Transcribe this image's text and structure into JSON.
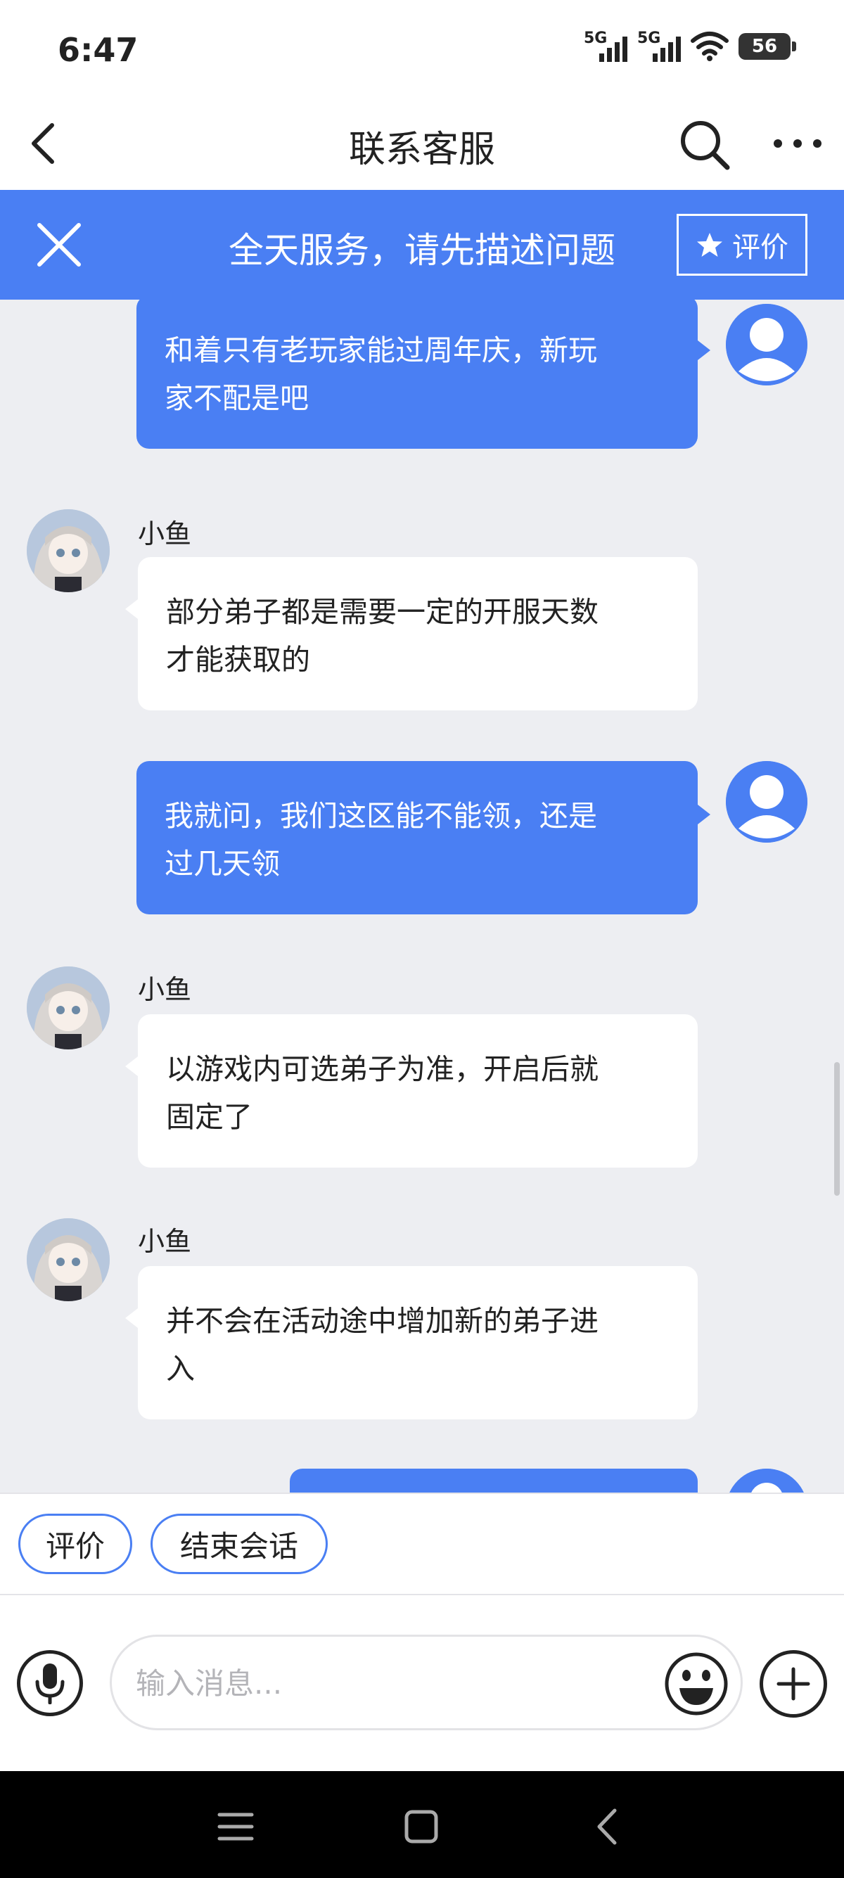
{
  "status_bar": {
    "time": "6:47",
    "network_1": "5G",
    "network_2": "5G",
    "battery": "56"
  },
  "header": {
    "title": "联系客服",
    "back_icon": "chevron-left-icon",
    "search_icon": "search-icon",
    "more_icon": "more-horizontal-icon"
  },
  "banner": {
    "text": "全天服务，请先描述问题",
    "rate_label": "评价",
    "close_icon": "close-icon",
    "star_icon": "star-icon"
  },
  "chat": {
    "messages": [
      {
        "from": "user",
        "lines": [
          "和着只有老玩家能过周年庆，新玩",
          "家不配是吧"
        ]
      },
      {
        "from": "agent",
        "sender": "小鱼",
        "lines": [
          "部分弟子都是需要一定的开服天数",
          "才能获取的"
        ]
      },
      {
        "from": "user",
        "lines": [
          "我就问，我们这区能不能领，还是",
          "过几天领"
        ]
      },
      {
        "from": "agent",
        "sender": "小鱼",
        "lines": [
          "以游戏内可选弟子为准，开启后就",
          "固定了"
        ]
      },
      {
        "from": "agent",
        "sender": "小鱼",
        "lines": [
          "并不会在活动途中增加新的弟子进",
          "入"
        ]
      }
    ]
  },
  "quick_actions": {
    "rate": "评价",
    "end_session": "结束会话"
  },
  "input": {
    "placeholder": "输入消息..."
  },
  "colors": {
    "accent": "#4a7ff3",
    "chat_bg": "#edeef2"
  }
}
